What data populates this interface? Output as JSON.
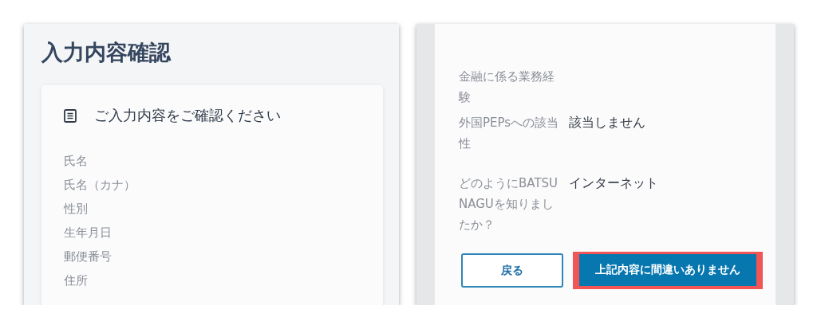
{
  "left_screen": {
    "title": "入力内容確認",
    "card_title": "ご入力内容をご確認ください",
    "fields": [
      {
        "label": "氏名"
      },
      {
        "label": "氏名（カナ）"
      },
      {
        "label": "性別"
      },
      {
        "label": "生年月日"
      },
      {
        "label": "郵便番号"
      },
      {
        "label": "住所"
      }
    ]
  },
  "right_screen": {
    "rows": [
      {
        "label": "金融に係る業務経験"
      },
      {
        "label": "外国PEPsへの該当性",
        "value": "該当しません"
      },
      {
        "label": "どのようにBATSUNAGUを知りましたか？",
        "value": "インターネット"
      }
    ],
    "buttons": [
      {
        "kind": "outline",
        "label": "戻る",
        "highlighted": false
      },
      {
        "kind": "primary",
        "label": "上記内容に間違いありません",
        "highlighted": true
      }
    ]
  }
}
